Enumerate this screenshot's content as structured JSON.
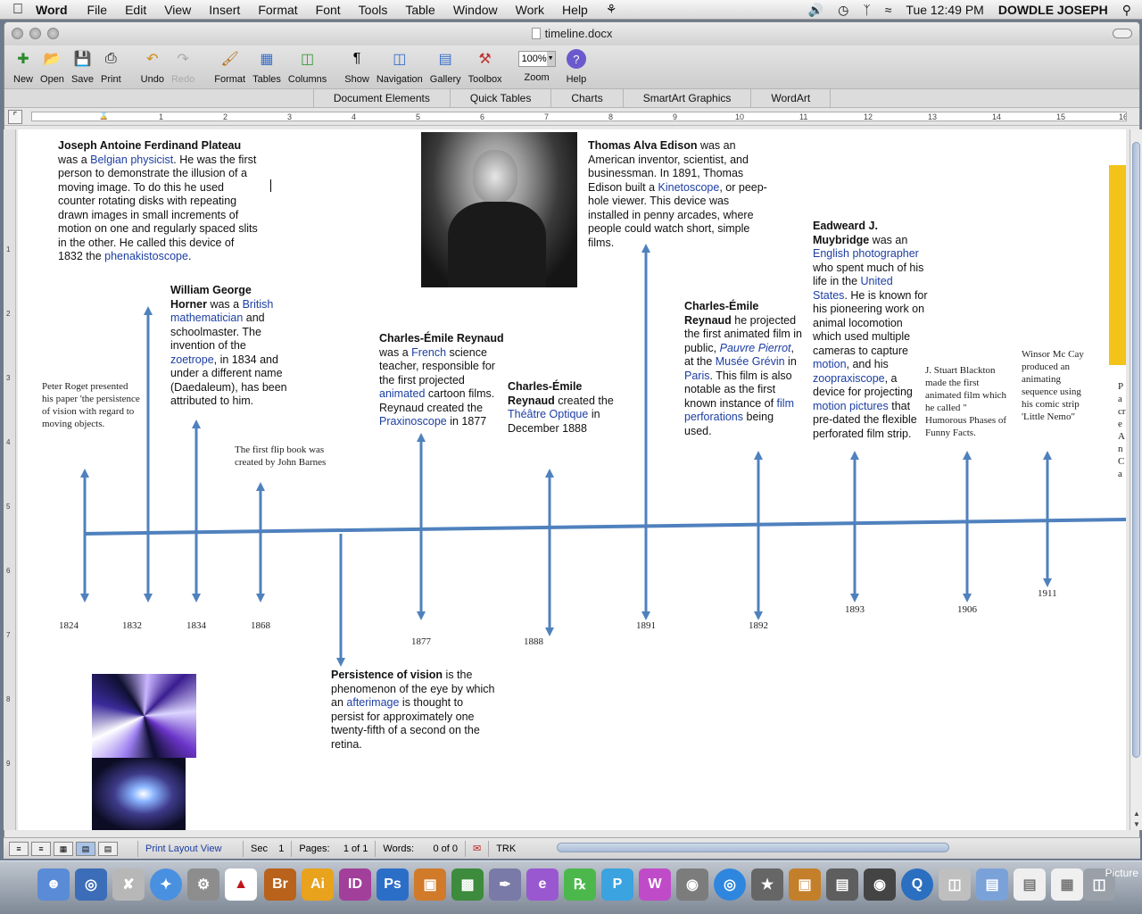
{
  "menubar": {
    "app": "Word",
    "items": [
      "File",
      "Edit",
      "View",
      "Insert",
      "Format",
      "Font",
      "Tools",
      "Table",
      "Window",
      "Work",
      "Help"
    ],
    "clock": "Tue 12:49 PM",
    "user": "DOWDLE JOSEPH"
  },
  "window": {
    "title": "timeline.docx"
  },
  "toolbar": {
    "buttons": [
      "New",
      "Open",
      "Save",
      "Print",
      "Undo",
      "Redo",
      "Format",
      "Tables",
      "Columns",
      "Show",
      "Navigation",
      "Gallery",
      "Toolbox",
      "Zoom",
      "Help"
    ],
    "zoom": "100%"
  },
  "ribbon": {
    "tabs": [
      "Document Elements",
      "Quick Tables",
      "Charts",
      "SmartArt Graphics",
      "WordArt"
    ]
  },
  "ruler": {
    "numbers": [
      "1",
      "2",
      "3",
      "4",
      "5",
      "6",
      "7",
      "8",
      "9",
      "10",
      "11",
      "12",
      "13",
      "14",
      "15",
      "16"
    ]
  },
  "vruler": {
    "numbers": [
      "1",
      "2",
      "3",
      "4",
      "5",
      "6",
      "7",
      "8",
      "9"
    ]
  },
  "document": {
    "plateau": {
      "name": "Joseph Antoine Ferdinand Plateau",
      "t1": " was a ",
      "link": "Belgian physicist",
      "t2": ". He was the first person to demonstrate the illusion of a moving image. To do this he used counter rotating disks with repeating drawn images in small increments of motion on one and regularly spaced slits in the other. He called this device of 1832 the ",
      "link2": "phenakistoscope",
      "t3": "."
    },
    "horner": {
      "name": "William George Horner",
      "t1": " was a ",
      "link": "British mathematician",
      "t2": " and schoolmaster. The invention of the ",
      "link2": "zoetrope",
      "t3": ", in 1834 and under a different name (Daedaleum), has been attributed to him."
    },
    "roget": "Peter Roget presented his paper 'the persistence of vision with regard to moving objects.",
    "flipbook": "The first flip book was created by John Barnes",
    "reynaud1": {
      "name": "Charles-Émile Reynaud",
      "t1": " was a ",
      "link": "French",
      "t2": " science teacher, responsible for the first projected ",
      "link2": "animated",
      "t3": " cartoon films. Reynaud created the ",
      "link3": "Praxinoscope",
      "t4": " in 1877"
    },
    "reynaud2": {
      "name": "Charles-Émile Reynaud",
      "t1": " created the ",
      "link": "Théâtre Optique",
      "t2": " in December 1888"
    },
    "edison": {
      "name": "Thomas Alva Edison",
      "t1": " was an American inventor, scientist, and businessman. In 1891, Thomas Edison built a ",
      "link": "Kinetoscope",
      "t2": ", or peep-hole viewer. This device was installed in penny arcades, where people could watch short, simple films."
    },
    "reynaud3": {
      "name": "Charles-Émile Reynaud",
      "t1": " he projected the first animated film in public, ",
      "link": "Pauvre Pierrot",
      "t2": ", at the ",
      "link2": "Musée Grévin",
      "t3": " in ",
      "link3": "Paris",
      "t4": ". This film is also notable as the first known instance of ",
      "link4": "film perforations",
      "t5": " being used."
    },
    "muybridge": {
      "name": "Eadweard J. Muybridge",
      "t1": " was an ",
      "link": "English photographer",
      "t2": " who spent much of his life in the ",
      "link2": "United States",
      "t3": ". He is known for his pioneering work on animal locomotion which used multiple cameras to capture ",
      "link3": "motion",
      "t4": ", and his ",
      "link4": "zoopraxiscope",
      "t5": ", a device for projecting ",
      "link5": "motion pictures",
      "t6": " that pre-dated the flexible perforated film strip."
    },
    "blackton": "J. Stuart Blackton made the first animated film which he called \" Humorous Phases of Funny Facts.",
    "mccay": "Winsor Mc Cay produced an animating sequence using his comic strip 'Little Nemo\"",
    "cutoff": "Pa cre An Ca",
    "persistence": {
      "name": "Persistence of vision",
      "t1": " is the phenomenon of the eye by which an ",
      "link": "afterimage",
      "t2": " is thought to persist for approximately one twenty-fifth of a second on the retina."
    },
    "years": [
      "1824",
      "1832",
      "1834",
      "1868",
      "1877",
      "1888",
      "1891",
      "1892",
      "1893",
      "1906",
      "1911"
    ]
  },
  "statusbar": {
    "view": "Print Layout View",
    "sec_label": "Sec",
    "sec": "1",
    "pages_label": "Pages:",
    "pages": "1 of 1",
    "words_label": "Words:",
    "words": "0 of 0",
    "trk": "TRK"
  },
  "dock": {
    "apps": [
      "Finder",
      "Network",
      "Script",
      "Safari",
      "System Preferences",
      "Acrobat",
      "Br",
      "Ai",
      "ID",
      "Ps",
      "Presentation",
      "Charts",
      "Pen",
      "Web",
      "Sketch",
      "Paint",
      "Mail",
      "Camera",
      "DVD",
      "iMovie",
      "Photos",
      "Preview",
      "Photo Booth",
      "QuickTime",
      "Archive",
      "Folder",
      "PDF",
      "Stickies",
      "Trash"
    ],
    "label": "Picture"
  }
}
